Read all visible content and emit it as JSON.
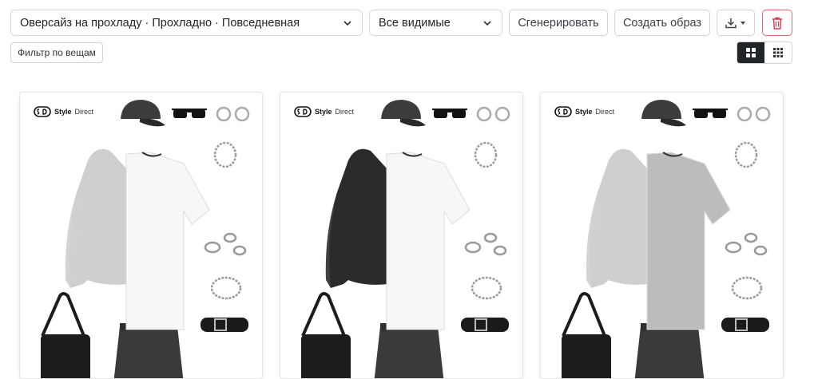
{
  "toolbar": {
    "outfit_select_value": "Оверсайз на прохладу · Прохладно · Повседневная",
    "visibility_select_value": "Все видимые",
    "generate_label": "Сгенерировать",
    "create_look_label": "Создать образ",
    "download_icon": "download-icon",
    "delete_icon": "trash-icon",
    "danger_color": "#dc3545"
  },
  "filter": {
    "label": "Фильтр по вещам"
  },
  "view": {
    "active": "large-grid",
    "options": [
      "large-grid",
      "small-grid"
    ]
  },
  "cards": [
    {
      "brand_bold": "Style",
      "brand_light": "Direct",
      "hoodie_color": "#cfcfcf",
      "tee_color": "#f7f7f7",
      "skirt_color": "#3a3a3a",
      "accent_bag": "#1c1c1c"
    },
    {
      "brand_bold": "Style",
      "brand_light": "Direct",
      "hoodie_color": "#2b2b2b",
      "tee_color": "#f7f7f7",
      "skirt_color": "#3a3a3a",
      "accent_bag": "#1c1c1c"
    },
    {
      "brand_bold": "Style",
      "brand_light": "Direct",
      "hoodie_color": "#cfcfcf",
      "tee_color": "#bcbcbc",
      "skirt_color": "#3a3a3a",
      "accent_bag": "#1c1c1c"
    }
  ]
}
